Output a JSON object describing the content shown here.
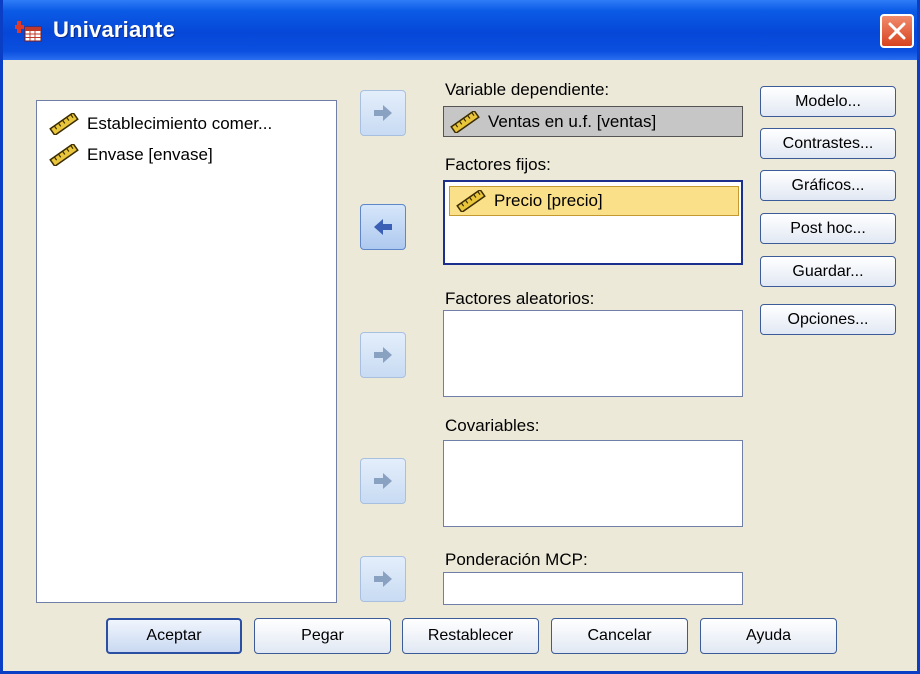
{
  "window": {
    "title": "Univariante"
  },
  "source_list": {
    "items": [
      {
        "label": "Establecimiento comer...",
        "icon": "ruler-icon"
      },
      {
        "label": "Envase [envase]",
        "icon": "ruler-icon"
      }
    ]
  },
  "fields": {
    "dependent": {
      "label": "Variable dependiente:",
      "value": "Ventas en u.f. [ventas]"
    },
    "fixed": {
      "label": "Factores fijos:",
      "items": [
        "Precio [precio]"
      ]
    },
    "random": {
      "label": "Factores aleatorios:"
    },
    "covariates": {
      "label": "Covariables:"
    },
    "wls": {
      "label": "Ponderación MCP:"
    }
  },
  "side_buttons": [
    "Modelo...",
    "Contrastes...",
    "Gráficos...",
    "Post hoc...",
    "Guardar...",
    "Opciones..."
  ],
  "bottom_buttons": [
    "Aceptar",
    "Pegar",
    "Restablecer",
    "Cancelar",
    "Ayuda"
  ],
  "colors": {
    "title_bar": "#0a4fdf",
    "selection": "#fbe08a",
    "close": "#d8431f"
  }
}
